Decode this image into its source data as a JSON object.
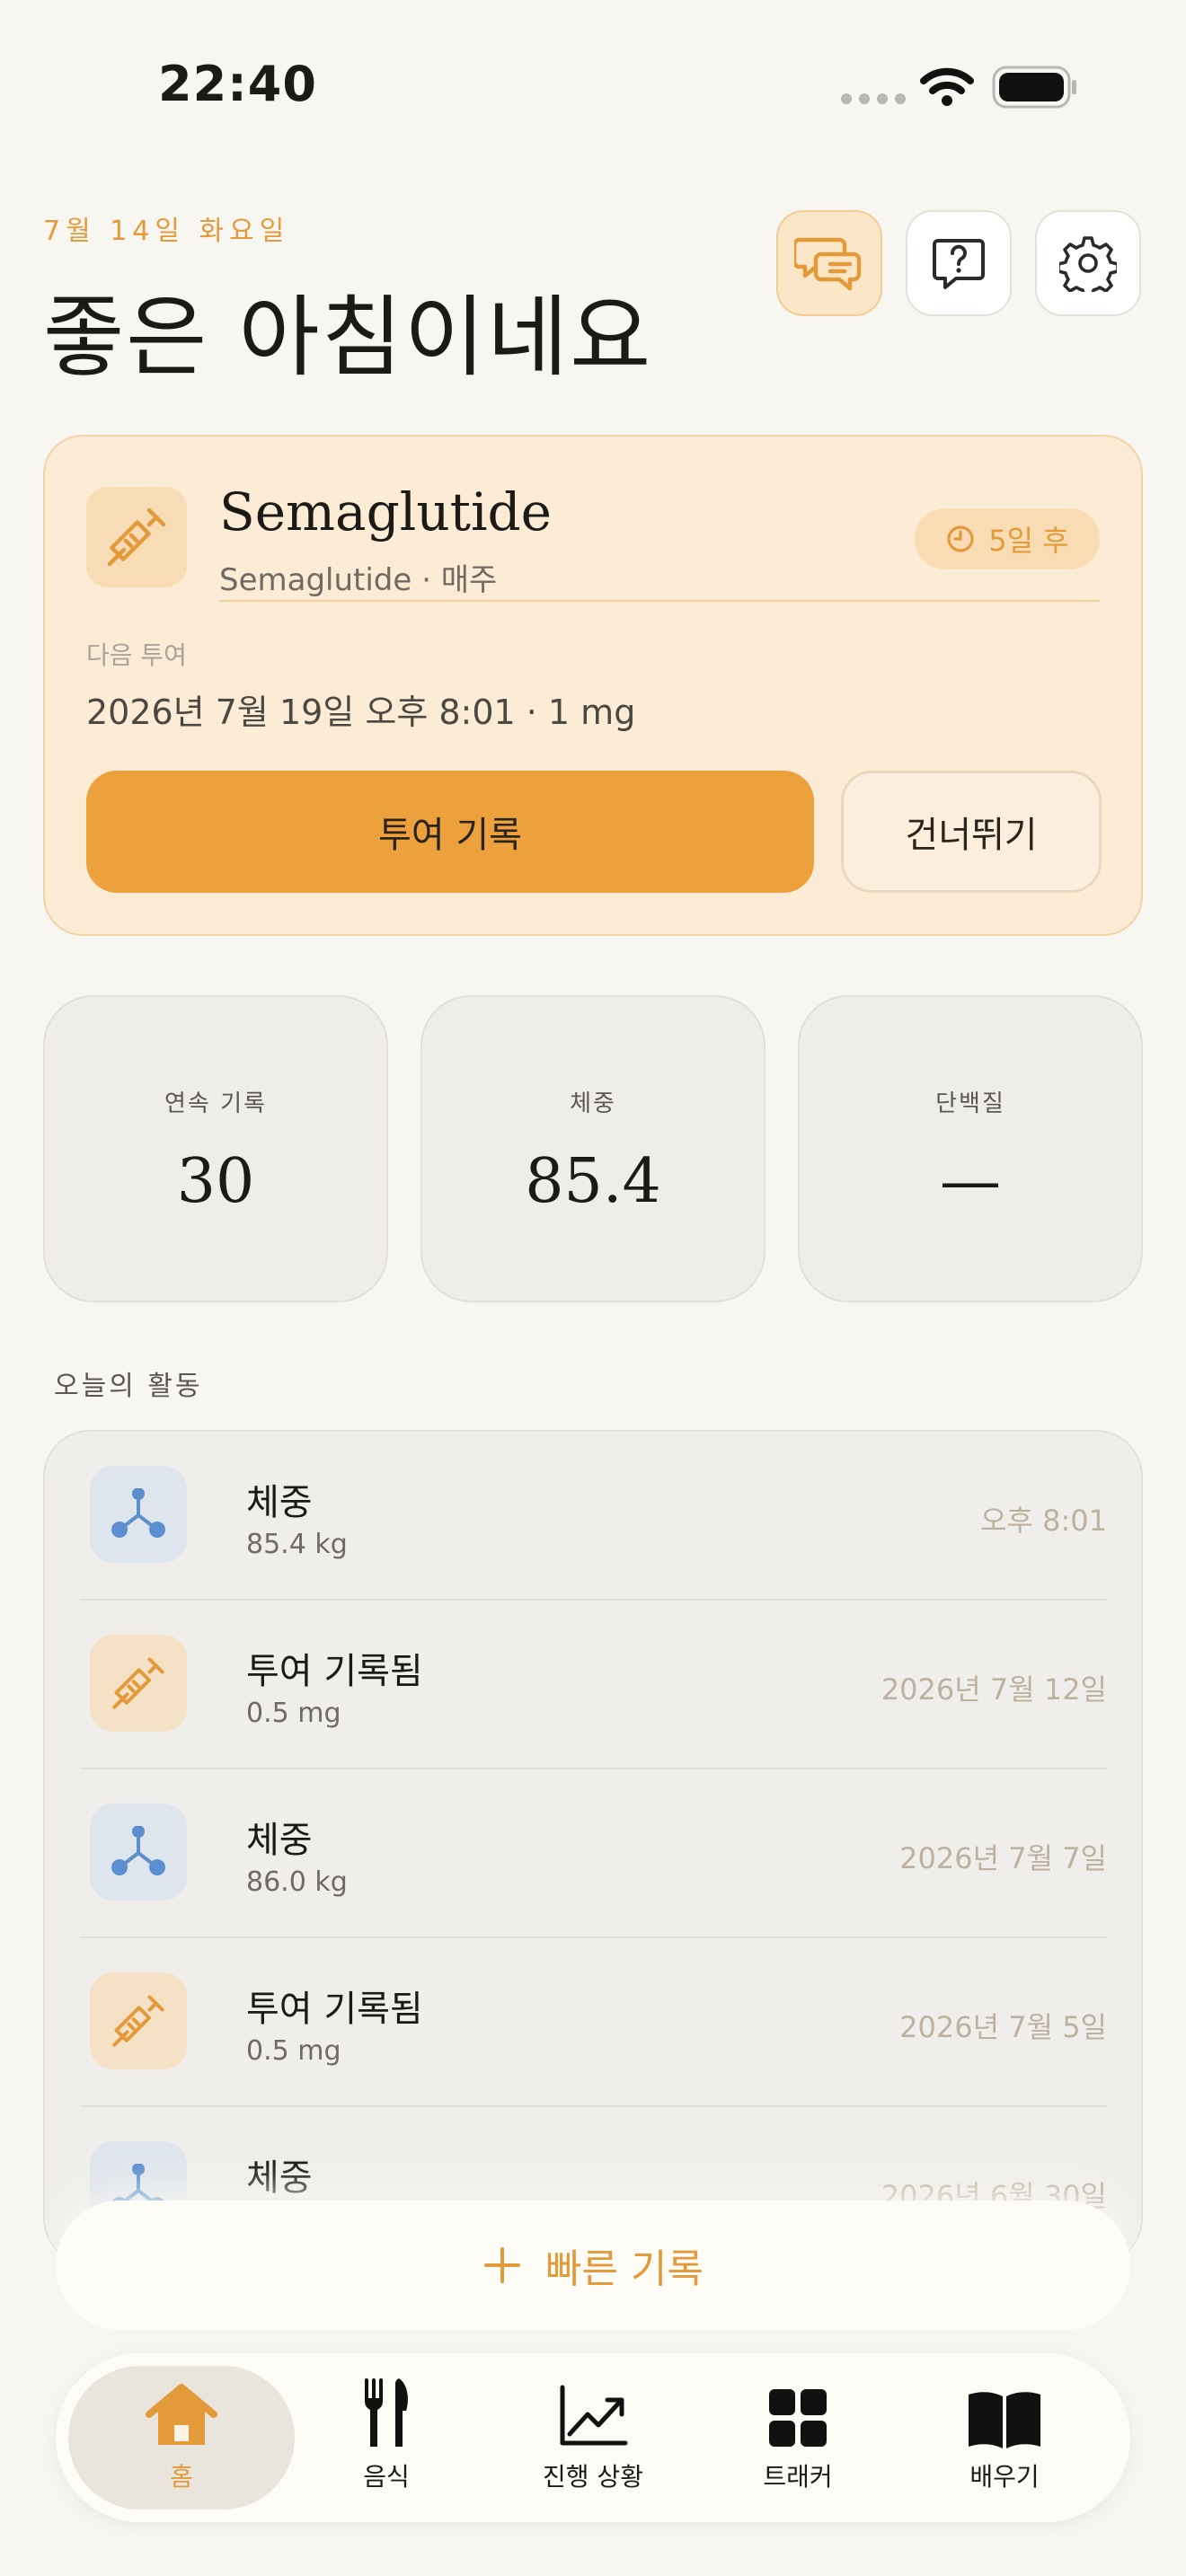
{
  "status_bar": {
    "time": "22:40"
  },
  "header": {
    "date": "7월 14일 화요일",
    "greeting": "좋은 아침이네요"
  },
  "header_buttons": [
    {
      "name": "chat-button",
      "icon": "chat-bubbles-icon"
    },
    {
      "name": "help-button",
      "icon": "question-icon"
    },
    {
      "name": "settings-button",
      "icon": "gear-icon"
    }
  ],
  "medication": {
    "icon": "syringe-icon",
    "name": "Semaglutide",
    "subtitle": "Semaglutide · 매주",
    "countdown": "5일 후",
    "next_label": "다음 투여",
    "next_value": "2026년 7월 19일 오후 8:01 · 1 mg",
    "log_button": "투여 기록",
    "skip_button": "건너뛰기"
  },
  "stats": [
    {
      "label": "연속 기록",
      "value": "30"
    },
    {
      "label": "체중",
      "value": "85.4"
    },
    {
      "label": "단백질",
      "value": "—"
    }
  ],
  "activity": {
    "title": "오늘의 활동",
    "items": [
      {
        "kind": "weight",
        "icon": "molecule-icon",
        "title": "체중",
        "sub": "85.4 kg",
        "date": "오후 8:01"
      },
      {
        "kind": "dose",
        "icon": "syringe-icon",
        "title": "투여 기록됨",
        "sub": "0.5 mg",
        "date": "2026년 7월 12일"
      },
      {
        "kind": "weight",
        "icon": "molecule-icon",
        "title": "체중",
        "sub": "86.0 kg",
        "date": "2026년 7월 7일"
      },
      {
        "kind": "dose",
        "icon": "syringe-icon",
        "title": "투여 기록됨",
        "sub": "0.5 mg",
        "date": "2026년 7월 5일"
      },
      {
        "kind": "weight",
        "icon": "molecule-icon",
        "title": "체중",
        "sub": "",
        "date": "2026년 6월 30일"
      }
    ]
  },
  "quick_log": {
    "label": "빠른 기록"
  },
  "tabs": [
    {
      "label": "홈",
      "icon": "home-icon",
      "active": true
    },
    {
      "label": "음식",
      "icon": "fork-knife-icon"
    },
    {
      "label": "진행 상황",
      "icon": "trend-chart-icon"
    },
    {
      "label": "트래커",
      "icon": "grid-icon"
    },
    {
      "label": "배우기",
      "icon": "book-icon"
    }
  ],
  "colors": {
    "accent": "#eca13d",
    "accent_text": "#e39a3a",
    "weight_blue": "#5b8fcf",
    "background": "#f8f6f1"
  }
}
